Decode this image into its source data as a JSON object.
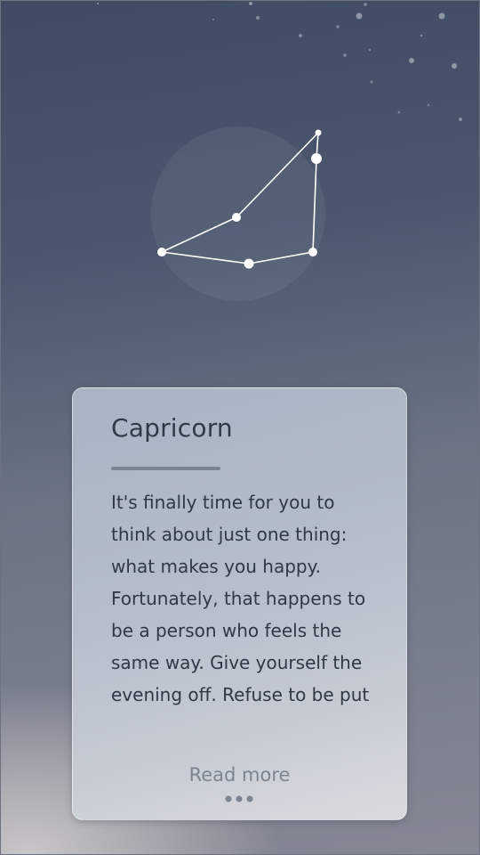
{
  "sign": {
    "name": "Capricorn",
    "horoscope": "It's finally time for you to think about just one thing: what makes you happy. Fortunately, that happens to be a person who feels the same way. Give yourself the evening off. Refuse to be put"
  },
  "actions": {
    "read_more_label": "Read more",
    "more_icon": "more-dots-icon"
  },
  "colors": {
    "sky_top": "#3f4b63",
    "card_background": "#b5bdca",
    "title_text": "#2f3a48",
    "body_text": "#2f3844",
    "link_text": "#7b8491",
    "constellation": "#ffffff"
  }
}
